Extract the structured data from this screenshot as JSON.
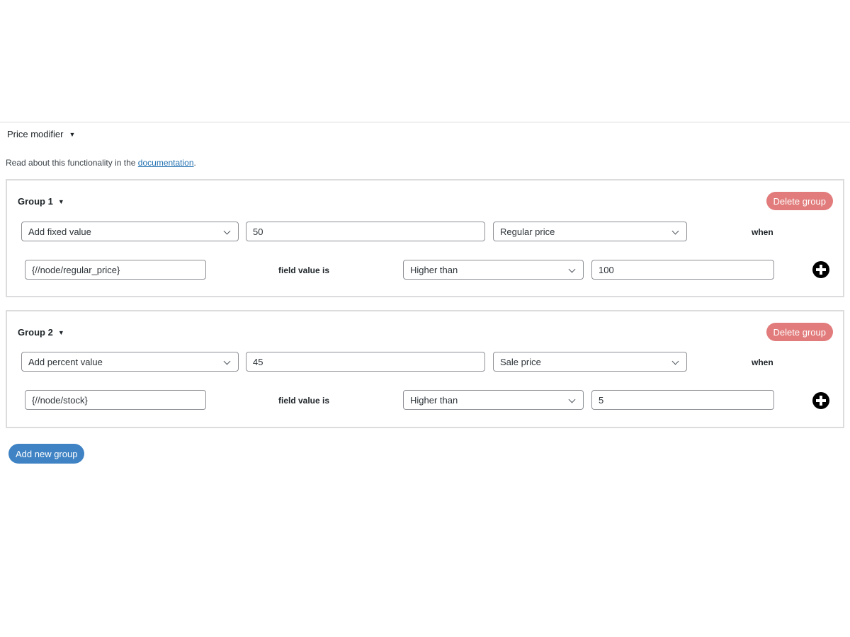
{
  "section": {
    "title": "Price modifier",
    "intro_text": "Read about this functionality in the ",
    "doc_link": "documentation",
    "intro_end": "."
  },
  "groups": [
    {
      "title": "Group 1",
      "delete_label": "Delete group",
      "modifier": "Add fixed value",
      "amount": "50",
      "price_type": "Regular price",
      "when_label": "when",
      "condition_field": "{//node/regular_price}",
      "field_value_label": "field value is",
      "comparator": "Higher than",
      "compare_value": "100"
    },
    {
      "title": "Group 2",
      "delete_label": "Delete group",
      "modifier": "Add percent value",
      "amount": "45",
      "price_type": "Sale price",
      "when_label": "when",
      "condition_field": "{//node/stock}",
      "field_value_label": "field value is",
      "comparator": "Higher than",
      "compare_value": "5"
    }
  ],
  "add_group_label": "Add new group",
  "icons": {
    "collapse": "triangle-down-icon",
    "add_condition": "plus-circle-icon",
    "select_arrow": "chevron-down-icon"
  },
  "colors": {
    "delete_button": "#e27b7b",
    "add_group_button": "#3f83c4",
    "link": "#2271b1"
  }
}
